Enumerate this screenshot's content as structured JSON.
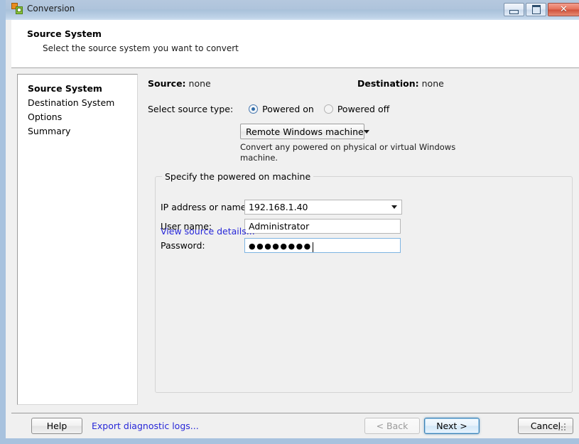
{
  "window": {
    "title": "Conversion",
    "icon": "app-squares-icon",
    "controls": {
      "minimize": "minimize-icon",
      "maximize": "maximize-icon",
      "close": "close-icon",
      "close_glyph": "✕"
    }
  },
  "header": {
    "title": "Source System",
    "subtitle": "Select the source system you want to convert"
  },
  "sidebar": {
    "items": [
      {
        "label": "Source System",
        "active": true
      },
      {
        "label": "Destination System",
        "active": false
      },
      {
        "label": "Options",
        "active": false
      },
      {
        "label": "Summary",
        "active": false
      }
    ]
  },
  "main": {
    "source": {
      "label": "Source:",
      "value": "none"
    },
    "destination": {
      "label": "Destination:",
      "value": "none"
    },
    "source_type": {
      "label": "Select source type:",
      "options": [
        {
          "label": "Powered on",
          "checked": true
        },
        {
          "label": "Powered off",
          "checked": false
        }
      ],
      "combo_value": "Remote Windows machine",
      "description": "Convert any powered on physical or virtual Windows machine."
    },
    "group": {
      "legend": "Specify the powered on machine",
      "fields": [
        {
          "label": "IP address or name:",
          "value": "192.168.1.40",
          "type": "combobox"
        },
        {
          "label": "User name:",
          "value": "Administrator",
          "type": "text"
        },
        {
          "label": "Password:",
          "value": "●●●●●●●●",
          "type": "password"
        }
      ]
    },
    "view_details_link": "View source details..."
  },
  "footer": {
    "help": "Help",
    "export_logs": "Export diagnostic logs...",
    "back": "< Back",
    "next": "Next >",
    "cancel": "Cancel"
  },
  "colors": {
    "link": "#2727d8",
    "titlebar": "#b5c8de",
    "accent_focus": "#3c7fb1",
    "panel": "#f0f0f0"
  }
}
